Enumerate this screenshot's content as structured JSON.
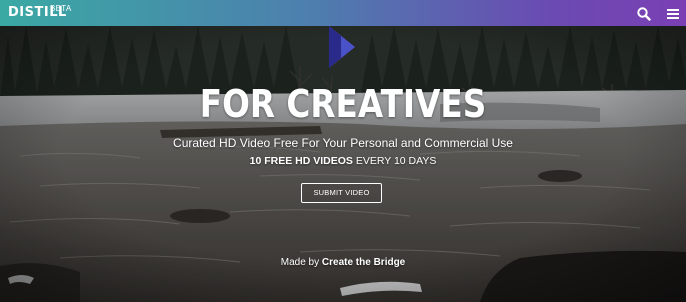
{
  "header": {
    "logo_text": "DISTILL",
    "beta_label": "BETA",
    "search_icon": "search-icon",
    "menu_icon": "hamburger-menu-icon"
  },
  "hero": {
    "headline": "FOR CREATIVES",
    "subheadline": "Curated HD Video Free For Your Personal and Commercial Use",
    "promo_strong": "10 FREE HD VIDEOS",
    "promo_rest": " EVERY 10 DAYS",
    "submit_label": "SUBMIT VIDEO",
    "madeby_prefix": "Made by ",
    "madeby_link": "Create the Bridge"
  },
  "colors": {
    "header_gradient_start": "#3aa9a3",
    "header_gradient_end": "#7a3fb4",
    "mark_light": "#5b3fb0",
    "mark_dark": "#2a2a8a",
    "text": "#ffffff"
  }
}
